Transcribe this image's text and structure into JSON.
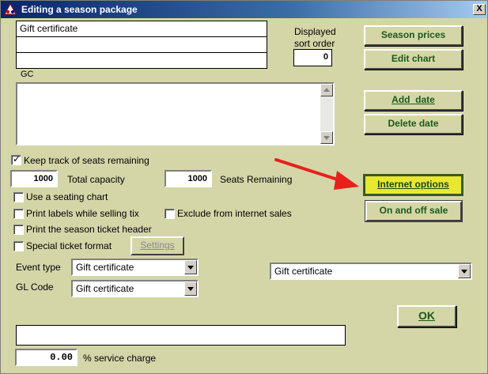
{
  "window": {
    "title": "Editing a season package",
    "close_glyph": "X"
  },
  "name_field": {
    "value": "Gift certificate"
  },
  "sort_order": {
    "label_line1": "Displayed",
    "label_line2": "sort order",
    "value": "0"
  },
  "description": {
    "label": "GC",
    "value": ""
  },
  "buttons": {
    "season_prices": "Season prices",
    "edit_chart": "Edit chart",
    "add_date": "Add  date",
    "delete_date": "Delete date",
    "internet_options": "Internet options",
    "on_and_off_sale": "On and off sale",
    "settings": "Settings",
    "ok": "OK"
  },
  "checkboxes": {
    "keep_track": {
      "label": "Keep track of seats remaining",
      "checked": true
    },
    "use_seating_chart": {
      "label": "Use a seating chart",
      "checked": false
    },
    "print_labels": {
      "label": "Print labels while selling tix",
      "checked": false
    },
    "exclude_internet": {
      "label": "Exclude from internet sales",
      "checked": false
    },
    "print_header": {
      "label": "Print the season ticket header",
      "checked": false
    },
    "special_format": {
      "label": "Special ticket format",
      "checked": false
    }
  },
  "capacity": {
    "value": "1000",
    "label": "Total capacity"
  },
  "remaining": {
    "value": "1000",
    "label": "Seats Remaining"
  },
  "event_type": {
    "label": "Event type",
    "value": "Gift certificate"
  },
  "gl_code": {
    "label": "GL Code",
    "value": "Gift certificate"
  },
  "right_combo": {
    "value": "Gift certificate"
  },
  "bottom_field": {
    "value": ""
  },
  "service_charge": {
    "value": "0.00",
    "label": "% service charge"
  },
  "colors": {
    "annotation_arrow": "#e8201c",
    "highlight_button": "#e8e830"
  }
}
